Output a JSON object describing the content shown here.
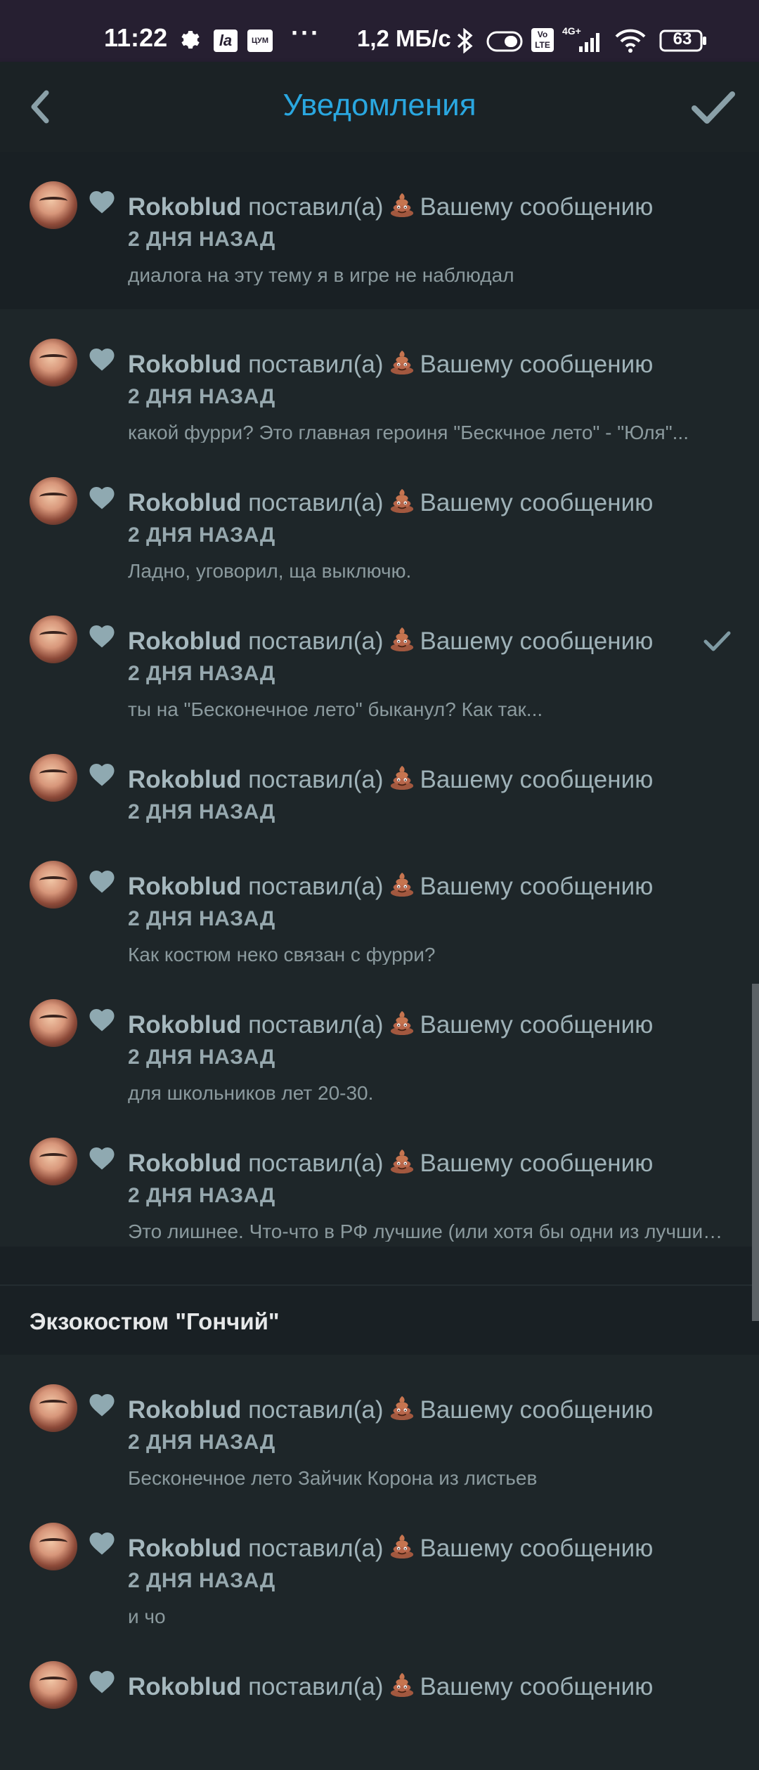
{
  "status_bar": {
    "time": "11:22",
    "speed": "1,2 МБ/с",
    "battery": "63",
    "icons": [
      "gear-icon",
      "la-app-icon",
      "tsum-app-icon",
      "more-dots-icon",
      "bluetooth-icon",
      "toggle-icon",
      "volte-icon",
      "signal-4g-icon",
      "wifi-icon",
      "battery-icon"
    ],
    "app_icon_1": "la",
    "app_icon_2": "ЦУМ",
    "dots": "···",
    "network": "4G+",
    "volte": "Vo LTE"
  },
  "app_bar": {
    "title": "Уведомления",
    "back_icon": "chevron-left-icon",
    "check_icon": "check-icon"
  },
  "colors": {
    "accent": "#2aa7e0",
    "background": "#1e2629",
    "status_bar": "#261f31"
  },
  "notification_template": {
    "action": "поставил(а)",
    "target": "Вашему сообщению",
    "reaction_icon": "poo-emoji-icon",
    "like_icon": "heart-icon"
  },
  "group1": [
    {
      "user": "Rokoblud",
      "time": "2 ДНЯ НАЗАД",
      "message": "диалога на эту тему я в игре не наблюдал"
    },
    {
      "user": "Rokoblud",
      "time": "2 ДНЯ НАЗАД",
      "message": "какой фурри? Это главная героиня \"Бескчное лето\" - \"Юля\"..."
    },
    {
      "user": "Rokoblud",
      "time": "2 ДНЯ НАЗАД",
      "message": "Ладно, уговорил, ща выключю."
    },
    {
      "user": "Rokoblud",
      "time": "2 ДНЯ НАЗАД",
      "message": "ты на \"Бесконечное лето\" быканул? Как так..."
    },
    {
      "user": "Rokoblud",
      "time": "2 ДНЯ НАЗАД",
      "message": ""
    },
    {
      "user": "Rokoblud",
      "time": "2 ДНЯ НАЗАД",
      "message": "Как костюм неко связан с фурри?"
    },
    {
      "user": "Rokoblud",
      "time": "2 ДНЯ НАЗАД",
      "message": "для школьников лет 20-30."
    },
    {
      "user": "Rokoblud",
      "time": "2 ДНЯ НАЗАД",
      "message": "Это лишнее. Что-что в РФ лучшие (или хотя бы одни из лучших)..."
    }
  ],
  "section2": {
    "title": "Экзокостюм \"Гончий\""
  },
  "group2": [
    {
      "user": "Rokoblud",
      "time": "2 ДНЯ НАЗАД",
      "message": "Бесконечное лето Зайчик Корона из листьев"
    },
    {
      "user": "Rokoblud",
      "time": "2 ДНЯ НАЗАД",
      "message": "и чо"
    },
    {
      "user": "Rokoblud",
      "time": "",
      "message": ""
    }
  ]
}
